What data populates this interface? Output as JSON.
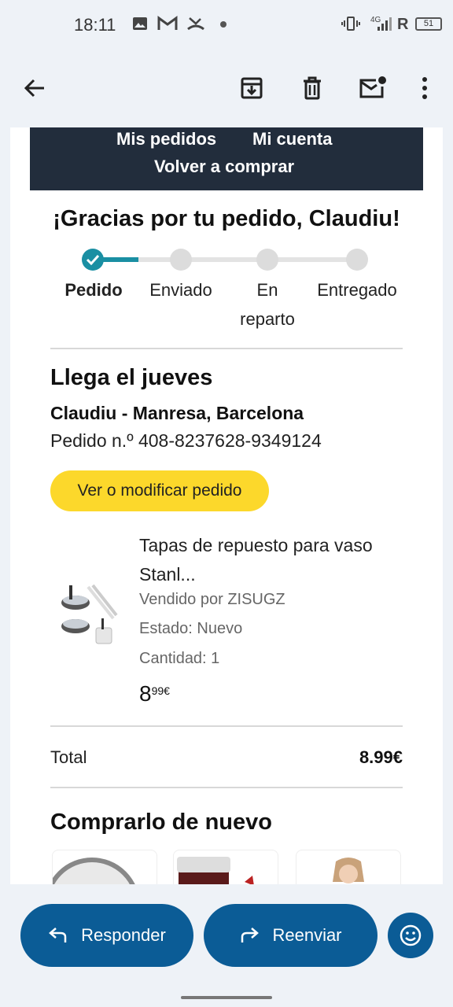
{
  "status_bar": {
    "time": "18:11",
    "signal_text": "4G",
    "roaming": "R",
    "battery": "51"
  },
  "app_bar": {
    "icons": [
      "back-arrow-icon",
      "archive-icon",
      "delete-icon",
      "mark-unread-icon",
      "more-icon"
    ]
  },
  "email": {
    "nav": {
      "my_orders": "Mis pedidos",
      "my_account": "Mi cuenta",
      "buy_again": "Volver a comprar"
    },
    "heading": "¡Gracias por tu pedido, Claudiu!",
    "progress": {
      "steps": [
        "Pedido",
        "Enviado",
        "En reparto",
        "Entregado"
      ],
      "current_step": 1,
      "accent_color": "#1a8fa3"
    },
    "arrival": "Llega el jueves",
    "recipient": "Claudiu - Manresa, Barcelona",
    "order_number": "Pedido n.º 408-8237628-9349124",
    "view_button": "Ver o modificar pedido",
    "item": {
      "title_line1": "Tapas de repuesto para vaso",
      "title_line2": "Stanl...",
      "seller": "Vendido por ZISUGZ",
      "condition": "Estado: Nuevo",
      "quantity": "Cantidad: 1",
      "price_whole": "8",
      "price_fraction": "99€"
    },
    "total_label": "Total",
    "total_value": "8.99€",
    "buy_again_title": "Comprarlo de nuevo"
  },
  "actions": {
    "reply": "Responder",
    "forward": "Reenviar"
  },
  "colors": {
    "primary": "#0b5c96",
    "header_dark": "#222d3c",
    "button_yellow": "#fcd82b"
  }
}
